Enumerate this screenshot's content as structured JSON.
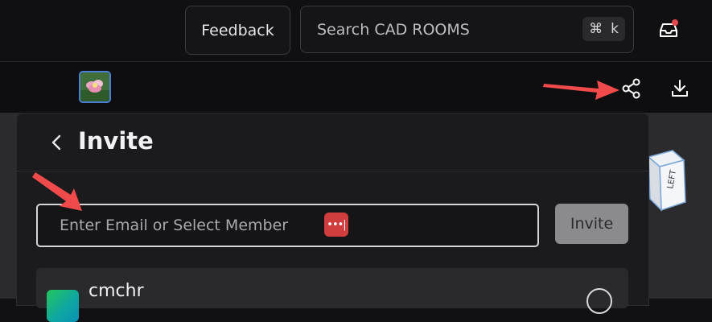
{
  "topbar": {
    "feedback_label": "Feedback",
    "search_placeholder": "Search CAD ROOMS",
    "shortcut_symbol": "⌘",
    "shortcut_key": "k",
    "inbox_icon": "inbox-icon",
    "notification_color": "#e5484d"
  },
  "subbar": {
    "thumbnail_icon": "model-thumbnail",
    "share_icon": "share-icon",
    "download_icon": "download-icon"
  },
  "viewcube": {
    "face_label": "LEFT"
  },
  "invite_panel": {
    "title": "Invite",
    "email_placeholder": "Enter Email or Select Member",
    "password_badge": "•••|",
    "invite_button": "Invite",
    "members": [
      {
        "name": "cmchr"
      }
    ]
  },
  "annotations": {
    "arrow_color": "#f04a4a"
  }
}
